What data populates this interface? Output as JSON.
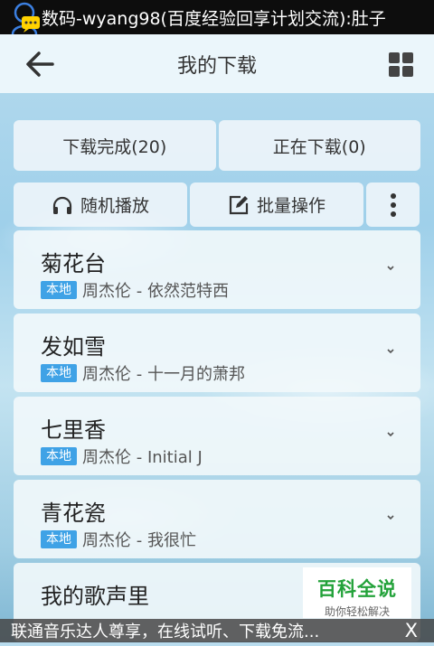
{
  "status_bar": {
    "title": "数码-wyang98(百度经验回享计划交流):肚子"
  },
  "header": {
    "title": "我的下载"
  },
  "tabs": [
    {
      "label": "下载完成(20)"
    },
    {
      "label": "正在下载(0)"
    }
  ],
  "actions": {
    "shuffle_label": "随机播放",
    "batch_label": "批量操作"
  },
  "songs": [
    {
      "title": "菊花台",
      "badge": "本地",
      "subtitle": "周杰伦 - 依然范特西"
    },
    {
      "title": "发如雪",
      "badge": "本地",
      "subtitle": "周杰伦 - 十一月的萧邦"
    },
    {
      "title": "七里香",
      "badge": "本地",
      "subtitle": "周杰伦 - Initial J"
    },
    {
      "title": "青花瓷",
      "badge": "本地",
      "subtitle": "周杰伦 - 我很忙"
    },
    {
      "title": "我的歌声里"
    }
  ],
  "watermark": {
    "main": "百科全说",
    "sub": "助你轻松解决"
  },
  "ad": {
    "text": "联通音乐达人尊享，在线试听、下载免流...",
    "close_label": "X"
  },
  "colors": {
    "badge": "#3fa2e6",
    "watermark_green": "#23a23a",
    "status_bar": "#0d0d0d"
  },
  "icons": {
    "app": "chat-avatar-icon",
    "back": "arrow-left-icon",
    "view": "grid-icon",
    "shuffle": "headphones-icon",
    "batch": "edit-icon",
    "more": "more-vertical-icon",
    "expand": "chevron-down-icon"
  }
}
